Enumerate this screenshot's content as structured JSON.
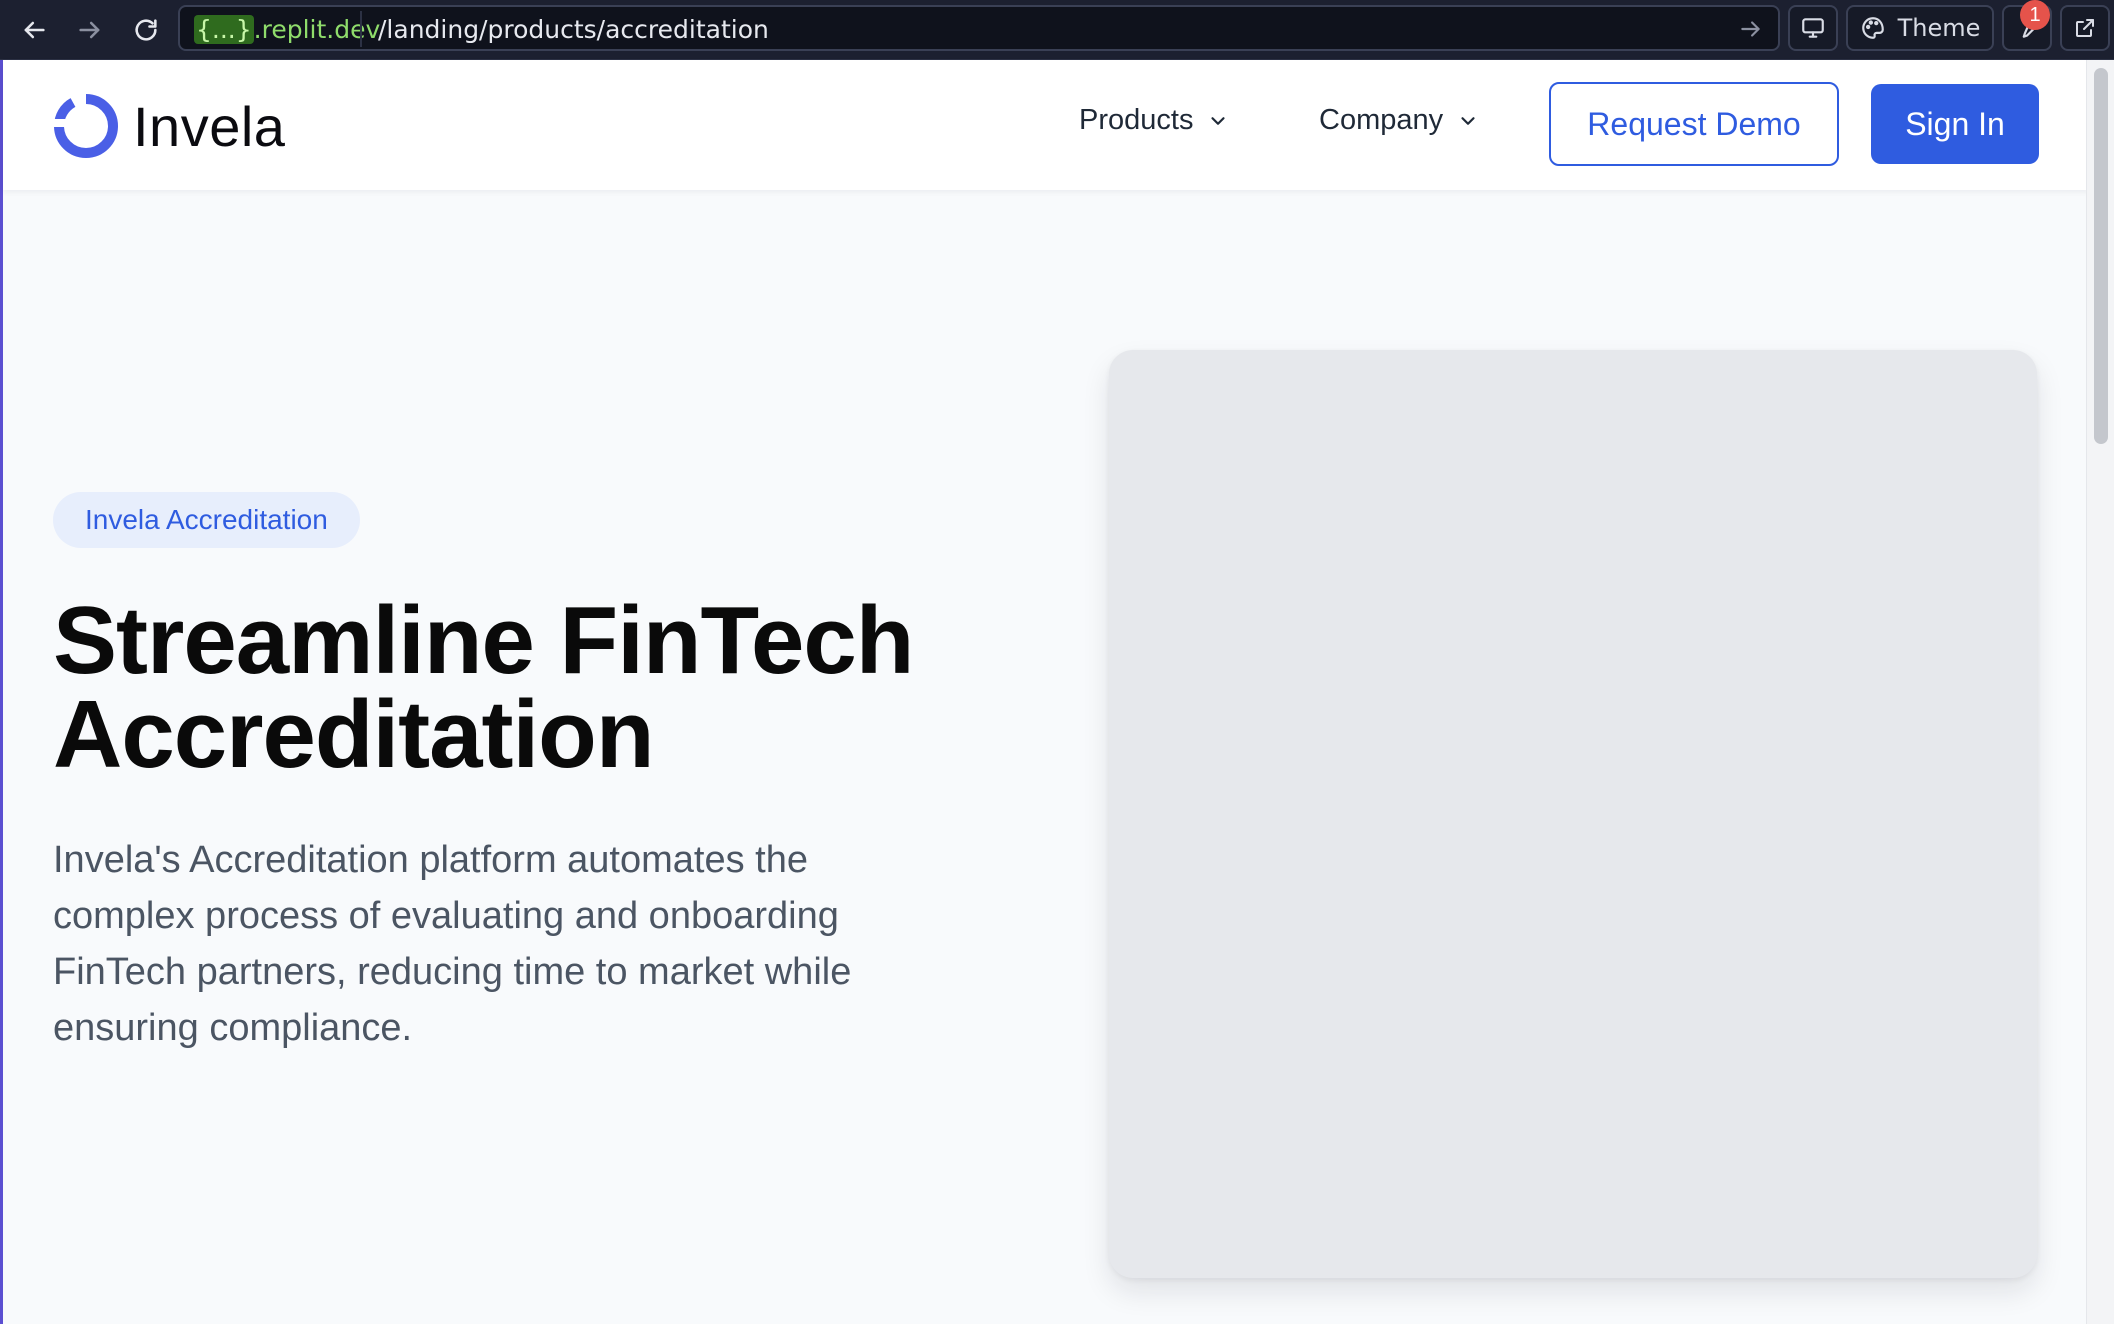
{
  "browser": {
    "url_host_brace": "{...}",
    "url_host_domain": ".replit.dev",
    "url_path": "/landing/products/accreditation",
    "theme_label": "Theme",
    "notification_count": "1"
  },
  "nav": {
    "logo_text": "Invela",
    "products_label": "Products",
    "company_label": "Company",
    "request_demo_label": "Request Demo",
    "sign_in_label": "Sign In"
  },
  "hero": {
    "badge": "Invela Accreditation",
    "title_line1": "Streamline FinTech",
    "title_line2": "Accreditation",
    "description": "Invela's Accreditation platform automates the complex process of evaluating and onboarding FinTech partners, reducing time to market while ensuring compliance."
  },
  "colors": {
    "brand_blue": "#2f5ce0",
    "toolbar_bg": "#1c2030",
    "page_bg": "#f8fafc"
  },
  "icons": {
    "back": "arrow-left-icon",
    "forward": "arrow-right-icon",
    "reload": "reload-icon",
    "go": "arrow-right-icon",
    "devices": "monitor-icon",
    "theme": "palette-icon",
    "tools": "wrench-icon",
    "external": "external-link-icon",
    "dropdown": "chevron-down-icon"
  }
}
